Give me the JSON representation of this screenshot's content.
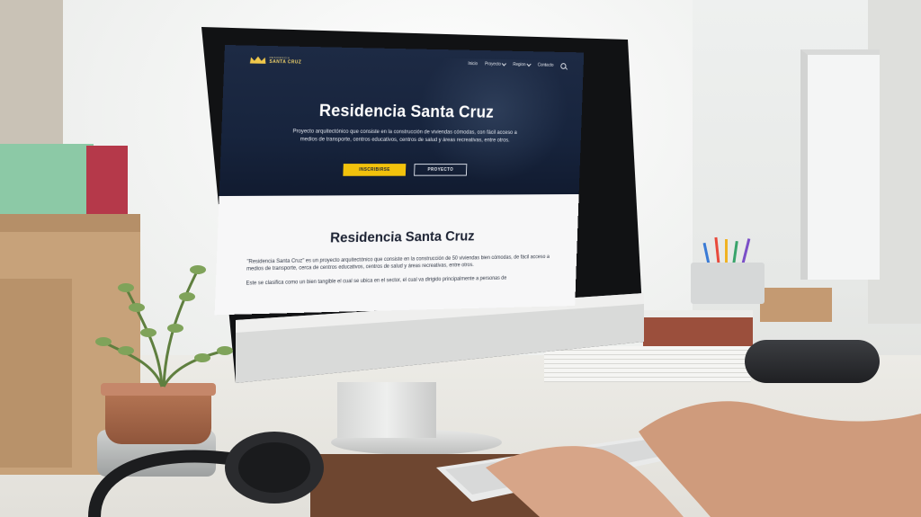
{
  "site": {
    "logo_small": "RESIDENCIA",
    "logo_name": "SANTA CRUZ",
    "nav": [
      {
        "label": "Inicio"
      },
      {
        "label": "Proyecto"
      },
      {
        "label": "Region"
      },
      {
        "label": "Contacto"
      }
    ],
    "hero_title": "Residencia Santa Cruz",
    "hero_description": "Proyecto arquitectónico que consiste en la construcción de viviendas cómodas, con fácil acceso a medios de transporte, centros educativos, centros de salud y áreas recreativas, entre otros.",
    "primary_button": "INSCRIBIRSE",
    "secondary_button": "PROYECTO",
    "section_title": "Residencia Santa Cruz",
    "paragraph_1": "\"Residencia Santa Cruz\" es un proyecto arquitectónico que consiste en la construcción de 50 viviendas bien cómodas, de fácil acceso a medios de transporte, cerca de centros educativos, centros de salud y áreas recreativas, entre otros.",
    "paragraph_2": "Este se clasifica como un bien tangible el cual se ubica en el sector, el cual va dirigido principalmente a personas de"
  },
  "colors": {
    "hero_bg": "#17243d",
    "accent_yellow": "#f2c20c",
    "content_bg": "#f7f7f8"
  }
}
